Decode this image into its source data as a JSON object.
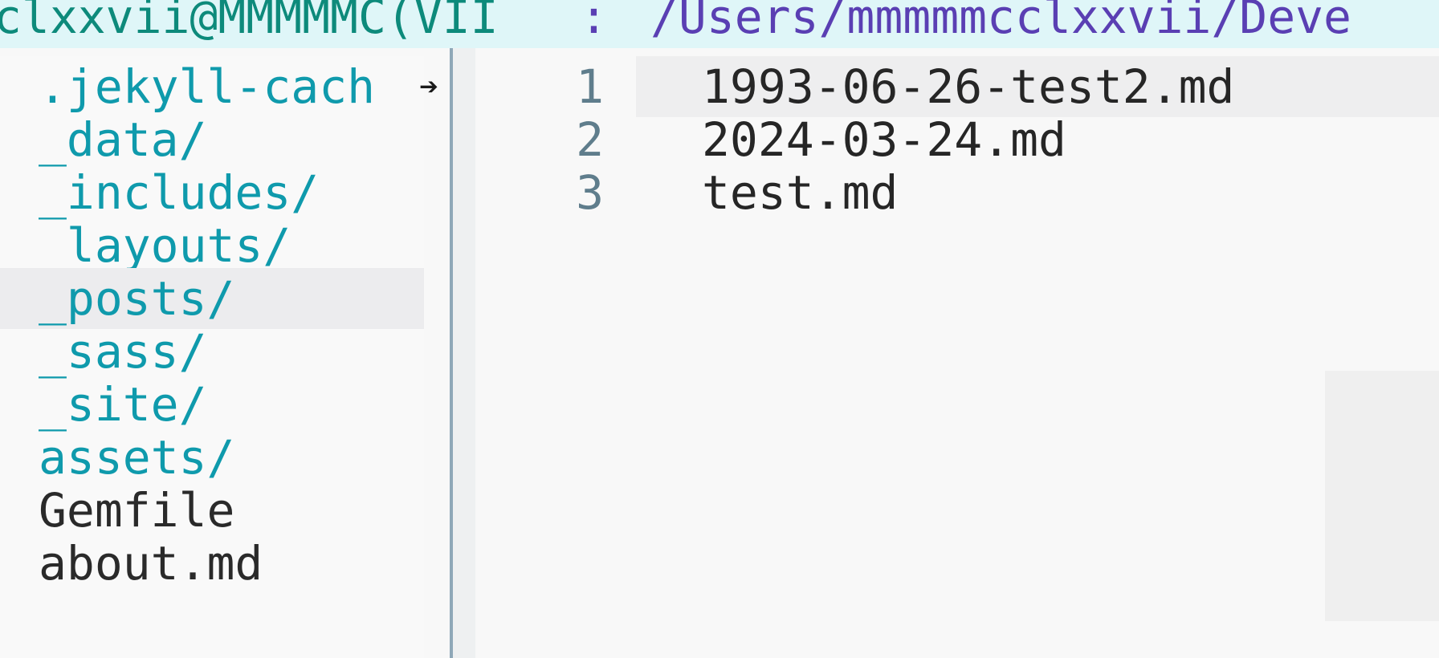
{
  "header": {
    "host": "clxxvii@MMMMMC(VII",
    "separator": ":",
    "path": "/Users/mmmmmcclxxvii/Deve"
  },
  "tree": {
    "items": [
      {
        "label": ".jekyll-cach",
        "type": "dir",
        "truncated": true
      },
      {
        "label": "_data/",
        "type": "dir"
      },
      {
        "label": "_includes/",
        "type": "dir"
      },
      {
        "label": "_layouts/",
        "type": "dir"
      },
      {
        "label": "_posts/",
        "type": "dir",
        "selected": true
      },
      {
        "label": "_sass/",
        "type": "dir"
      },
      {
        "label": "_site/",
        "type": "dir"
      },
      {
        "label": "assets/",
        "type": "dir"
      },
      {
        "label": "Gemfile",
        "type": "file"
      },
      {
        "label": "about.md",
        "type": "file"
      }
    ],
    "truncation_glyph": "➔"
  },
  "editor": {
    "lines": [
      {
        "number": "1",
        "text": "1993-06-26-test2.md"
      },
      {
        "number": "2",
        "text": "2024-03-24.md"
      },
      {
        "number": "3",
        "text": "test.md"
      }
    ]
  },
  "colors": {
    "header_bg": "#dff6f8",
    "host": "#0d8a7b",
    "path": "#5a3fb3",
    "directory": "#0f9aac",
    "file": "#2a2a2a",
    "line_number": "#5f7d8c"
  }
}
